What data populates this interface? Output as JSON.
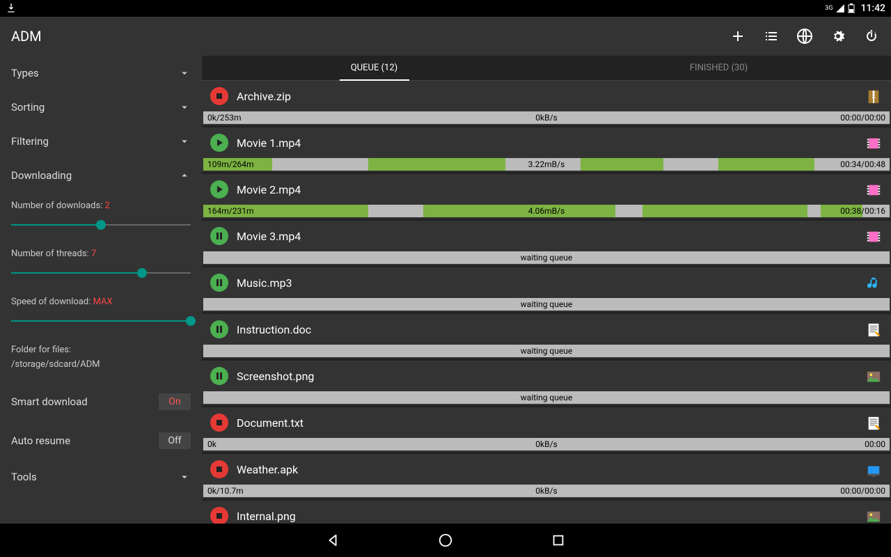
{
  "status": {
    "network": "3G",
    "clock": "11:42"
  },
  "app": {
    "title": "ADM"
  },
  "sidebar": {
    "types": "Types",
    "sorting": "Sorting",
    "filtering": "Filtering",
    "downloading": "Downloading",
    "tools": "Tools",
    "num_downloads_label": "Number of downloads:",
    "num_downloads_value": "2",
    "num_downloads_pct": 50,
    "num_threads_label": "Number of threads:",
    "num_threads_value": "7",
    "num_threads_pct": 73,
    "speed_label": "Speed of download:",
    "speed_value": "MAX",
    "speed_pct": 100,
    "folder_label": "Folder for files:",
    "folder_value": "/storage/sdcard/ADM",
    "smart_label": "Smart download",
    "smart_value": "On",
    "auto_label": "Auto resume",
    "auto_value": "Off"
  },
  "tabs": {
    "queue": "QUEUE (12)",
    "finished": "FINISHED (30)"
  },
  "items": [
    {
      "name": "Archive.zip",
      "btn": "stop",
      "type": "zip",
      "left": "0k/253m",
      "center": "0kB/s",
      "right": "00:00/00:00",
      "segments": []
    },
    {
      "name": "Movie 1.mp4",
      "btn": "play",
      "type": "video",
      "left": "109m/264m",
      "center": "3.22mB/s",
      "right": "00:34/00:48",
      "segments": [
        [
          0,
          10
        ],
        [
          24,
          44
        ],
        [
          55,
          67
        ],
        [
          75,
          89
        ]
      ]
    },
    {
      "name": "Movie 2.mp4",
      "btn": "play",
      "type": "video",
      "left": "164m/231m",
      "center": "4.06mB/s",
      "right": "00:38/00:16",
      "segments": [
        [
          0,
          24
        ],
        [
          32,
          60
        ],
        [
          64,
          88
        ],
        [
          90,
          96
        ]
      ]
    },
    {
      "name": "Movie 3.mp4",
      "btn": "pause",
      "type": "video",
      "waiting": "waiting queue"
    },
    {
      "name": "Music.mp3",
      "btn": "pause",
      "type": "music",
      "waiting": "waiting queue"
    },
    {
      "name": "Instruction.doc",
      "btn": "pause",
      "type": "doc",
      "waiting": "waiting queue"
    },
    {
      "name": "Screenshot.png",
      "btn": "pause",
      "type": "image",
      "waiting": "waiting queue"
    },
    {
      "name": "Document.txt",
      "btn": "stop",
      "type": "doc",
      "left": "0k",
      "center": "0kB/s",
      "right": "00:00",
      "segments": []
    },
    {
      "name": "Weather.apk",
      "btn": "stop",
      "type": "apk",
      "left": "0k/10.7m",
      "center": "0kB/s",
      "right": "00:00/00:00",
      "segments": []
    },
    {
      "name": "Internal.png",
      "btn": "stop",
      "type": "image"
    }
  ]
}
